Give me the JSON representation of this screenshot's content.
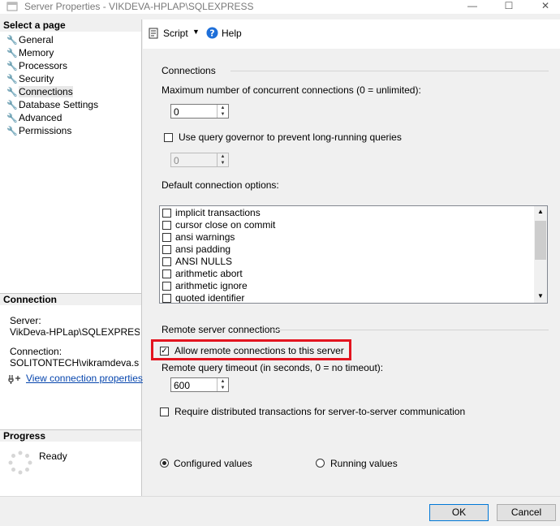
{
  "window": {
    "title": "Server Properties - VIKDEVA-HPLAP\\SQLEXPRESS",
    "minimize": "—",
    "maximize": "☐",
    "close": "✕"
  },
  "left": {
    "select_page_header": "Select a page",
    "pages": [
      "General",
      "Memory",
      "Processors",
      "Security",
      "Connections",
      "Database Settings",
      "Advanced",
      "Permissions"
    ],
    "selected_page": "Connections",
    "connection_header": "Connection",
    "server_label": "Server:",
    "server_value": "VikDeva-HPLap\\SQLEXPRESS",
    "connection_label": "Connection:",
    "connection_value": "SOLITONTECH\\vikramdeva.sridha",
    "view_props_link": "View connection properties",
    "progress_header": "Progress",
    "progress_status": "Ready"
  },
  "toolbar": {
    "script_label": "Script",
    "help_label": "Help"
  },
  "connections": {
    "section_title": "Connections",
    "max_conn_label": "Maximum number of concurrent connections (0 = unlimited):",
    "max_conn_value": "0",
    "governor_label": "Use query governor to prevent long-running queries",
    "governor_checked": false,
    "governor_value": "0",
    "default_options_label": "Default connection options:",
    "options": [
      {
        "label": "implicit transactions",
        "checked": false
      },
      {
        "label": "cursor close on commit",
        "checked": false
      },
      {
        "label": "ansi warnings",
        "checked": false
      },
      {
        "label": "ansi padding",
        "checked": false
      },
      {
        "label": "ANSI NULLS",
        "checked": false
      },
      {
        "label": "arithmetic abort",
        "checked": false
      },
      {
        "label": "arithmetic ignore",
        "checked": false
      },
      {
        "label": "quoted identifier",
        "checked": false
      }
    ]
  },
  "remote": {
    "section_title": "Remote server connections",
    "allow_label": "Allow remote connections to this server",
    "allow_checked": true,
    "timeout_label": "Remote query timeout (in seconds, 0 = no timeout):",
    "timeout_value": "600",
    "distributed_label": "Require distributed transactions for server-to-server communication",
    "distributed_checked": false
  },
  "values_mode": {
    "configured_label": "Configured values",
    "running_label": "Running values",
    "selected": "configured"
  },
  "buttons": {
    "ok": "OK",
    "cancel": "Cancel"
  },
  "colors": {
    "highlight_box": "#e3141f",
    "link": "#0645ad",
    "help_icon": "#1e6fd9"
  }
}
